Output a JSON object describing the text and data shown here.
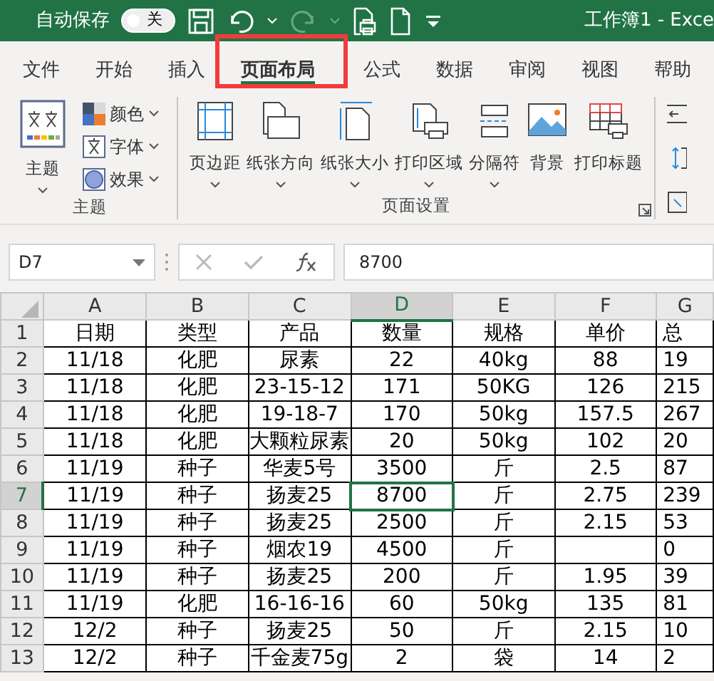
{
  "title_bar": {
    "autosave_label": "自动保存",
    "autosave": {
      "on": false,
      "label": "关"
    },
    "undo": {
      "disabled": false
    },
    "redo": {
      "disabled": true
    },
    "title": "工作簿1  -  Exce"
  },
  "tabs": [
    {
      "label": "文件",
      "selected": false
    },
    {
      "label": "开始",
      "selected": false
    },
    {
      "label": "插入",
      "selected": false
    },
    {
      "label": "页面布局",
      "selected": true
    },
    {
      "label": "公式",
      "selected": false
    },
    {
      "label": "数据",
      "selected": false
    },
    {
      "label": "审阅",
      "selected": false
    },
    {
      "label": "视图",
      "selected": false
    },
    {
      "label": "帮助",
      "selected": false
    }
  ],
  "ribbon": {
    "groups": [
      {
        "label": "主题",
        "launcher": false,
        "buttons": [
          {
            "kind": "themes",
            "label": "主题",
            "dropdown": true
          },
          {
            "kind": "colors",
            "label": "颜色",
            "dropdown": true
          },
          {
            "kind": "fonts",
            "label": "字体",
            "dropdown": true
          },
          {
            "kind": "effects",
            "label": "效果",
            "dropdown": true
          }
        ]
      },
      {
        "label": "页面设置",
        "launcher": true,
        "buttons": [
          {
            "kind": "margins",
            "label": "页边距",
            "dropdown": true
          },
          {
            "kind": "orientation",
            "label": "纸张方向",
            "dropdown": true
          },
          {
            "kind": "size",
            "label": "纸张大小",
            "dropdown": true
          },
          {
            "kind": "print-area",
            "label": "打印区域",
            "dropdown": true
          },
          {
            "kind": "breaks",
            "label": "分隔符",
            "dropdown": true
          },
          {
            "kind": "background",
            "label": "背景",
            "dropdown": false
          },
          {
            "kind": "print-titles",
            "label": "打印标题",
            "dropdown": false
          }
        ]
      }
    ]
  },
  "formula_bar": {
    "name_box": "D7",
    "formula": "8700"
  },
  "sheet": {
    "columns": [
      {
        "label": "A",
        "selected": false
      },
      {
        "label": "B",
        "selected": false
      },
      {
        "label": "C",
        "selected": false
      },
      {
        "label": "D",
        "selected": true
      },
      {
        "label": "E",
        "selected": false
      },
      {
        "label": "F",
        "selected": false
      },
      {
        "label": "G",
        "selected": false
      }
    ],
    "rows": [
      {
        "header": "1",
        "selected": false,
        "cells": [
          "日期",
          "类型",
          "产品",
          "数量",
          "规格",
          "单价",
          "总"
        ]
      },
      {
        "header": "2",
        "selected": false,
        "cells": [
          "11/18",
          "化肥",
          "尿素",
          "22",
          "40kg",
          "88",
          "19"
        ]
      },
      {
        "header": "3",
        "selected": false,
        "cells": [
          "11/18",
          "化肥",
          "23-15-12",
          "171",
          "50KG",
          "126",
          "215"
        ]
      },
      {
        "header": "4",
        "selected": false,
        "cells": [
          "11/18",
          "化肥",
          "19-18-7",
          "170",
          "50kg",
          "157.5",
          "267"
        ]
      },
      {
        "header": "5",
        "selected": false,
        "cells": [
          "11/18",
          "化肥",
          "大颗粒尿素",
          "20",
          "50kg",
          "102",
          "20"
        ]
      },
      {
        "header": "6",
        "selected": false,
        "cells": [
          "11/19",
          "种子",
          "华麦5号",
          "3500",
          "斤",
          "2.5",
          "87"
        ]
      },
      {
        "header": "7",
        "selected": true,
        "cells": [
          "11/19",
          "种子",
          "扬麦25",
          "8700",
          "斤",
          "2.75",
          "239"
        ]
      },
      {
        "header": "8",
        "selected": false,
        "cells": [
          "11/19",
          "种子",
          "扬麦25",
          "2500",
          "斤",
          "2.15",
          "53"
        ]
      },
      {
        "header": "9",
        "selected": false,
        "cells": [
          "11/19",
          "种子",
          "烟农19",
          "4500",
          "斤",
          null,
          "0"
        ]
      },
      {
        "header": "10",
        "selected": false,
        "cells": [
          "11/19",
          "种子",
          "扬麦25",
          "200",
          "斤",
          "1.95",
          "39"
        ]
      },
      {
        "header": "11",
        "selected": false,
        "cells": [
          "11/19",
          "化肥",
          "16-16-16",
          "60",
          "50kg",
          "135",
          "81"
        ]
      },
      {
        "header": "12",
        "selected": false,
        "cells": [
          "12/2",
          "种子",
          "扬麦25",
          "50",
          "斤",
          "2.15",
          "10"
        ]
      },
      {
        "header": "13",
        "selected": false,
        "cells": [
          "12/2",
          "种子",
          "千金麦75g",
          "2",
          "袋",
          "14",
          "2"
        ]
      }
    ]
  }
}
